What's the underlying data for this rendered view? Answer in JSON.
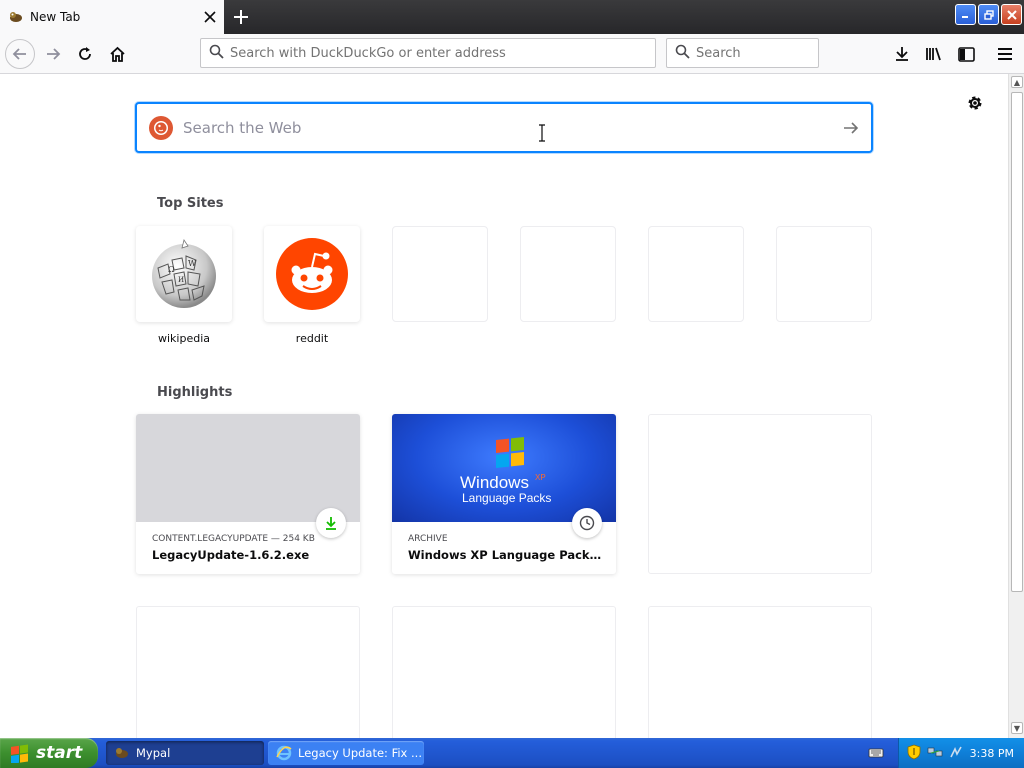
{
  "browser": {
    "tab": {
      "title": "New Tab"
    },
    "urlbar": {
      "placeholder": "Search with DuckDuckGo or enter address"
    },
    "searchbar": {
      "placeholder": "Search"
    }
  },
  "newtab": {
    "search": {
      "placeholder": "Search the Web"
    },
    "top_sites": {
      "title": "Top Sites",
      "items": [
        {
          "label": "wikipedia",
          "icon": "wikipedia-globe-icon"
        },
        {
          "label": "reddit",
          "icon": "reddit-alien-icon"
        }
      ]
    },
    "highlights": {
      "title": "Highlights",
      "items": [
        {
          "meta": "CONTENT.LEGACYUPDATE — 254 KB",
          "title": "LegacyUpdate-1.6.2.exe",
          "badge": "download-icon"
        },
        {
          "meta": "ARCHIVE",
          "title": "Windows XP Language Packs : M...",
          "badge": "clock-icon",
          "image_text": [
            "Windows",
            "XP",
            "Language Packs"
          ]
        }
      ]
    }
  },
  "taskbar": {
    "start_label": "start",
    "tasks": [
      {
        "label": "Mypal"
      },
      {
        "label": "Legacy Update: Fix ..."
      }
    ],
    "clock": "3:38 PM"
  },
  "colors": {
    "accent": "#0a84ff",
    "reddit": "#ff4500",
    "ddg": "#de5833",
    "download_green": "#12bc00"
  }
}
